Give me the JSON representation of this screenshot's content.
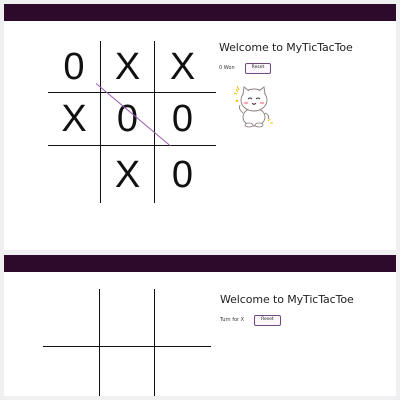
{
  "top_game": {
    "title": "Welcome to MyTicTacToe",
    "status": "0 Won",
    "reset_label": "Reset",
    "cells": [
      "0",
      "X",
      "X",
      "X",
      "0",
      "0",
      "",
      "X",
      "0"
    ],
    "winning_line": "diagonal top-left to bottom-right",
    "win_line_color": "#a05cb5",
    "celebration_image": "happy-white-cat-sticker"
  },
  "bottom_game": {
    "title": "Welcome to MyTicTacToe",
    "status": "Turn for X",
    "reset_label": "Reset",
    "cells": [
      "",
      "",
      "",
      "",
      "",
      "",
      "",
      "",
      ""
    ]
  },
  "colors": {
    "header_bar": "#2d0a2b",
    "grid": "#111111",
    "button_border": "#6f4a80"
  }
}
